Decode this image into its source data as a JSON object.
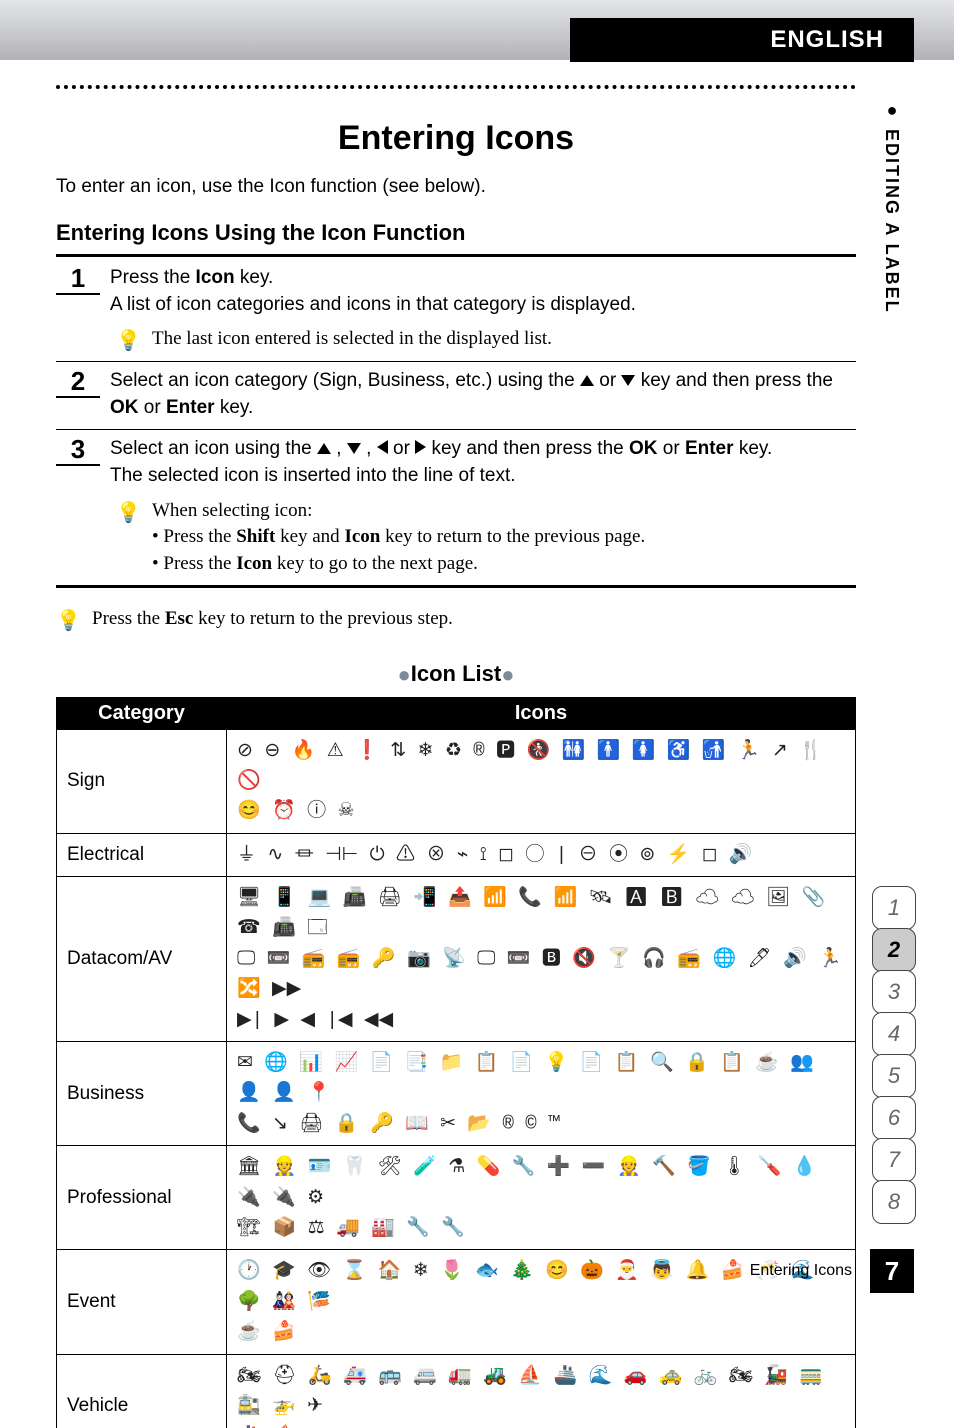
{
  "header": {
    "language_tab": "ENGLISH",
    "side_section_label": "EDITING A LABEL"
  },
  "page": {
    "title": "Entering Icons",
    "intro": "To enter an icon, use the Icon function (see below).",
    "section_heading": "Entering Icons Using the Icon Function"
  },
  "steps": [
    {
      "num": "1",
      "line1_before": "Press the ",
      "line1_key": "Icon",
      "line1_after": " key.",
      "line2": "A list of icon categories and icons in that category is displayed.",
      "tip": "The last icon entered is selected in the displayed list."
    },
    {
      "num": "2",
      "line_before": "Select an icon category (Sign, Business, etc.) using the ",
      "line_mid": " or ",
      "line_after_arrows": " key and then press the ",
      "key1": "OK",
      "or": " or ",
      "key2": "Enter",
      "line_end": " key."
    },
    {
      "num": "3",
      "line1_before": "Select an icon using the ",
      "sep": " , ",
      "or": " or ",
      "line1_mid": " key and then press the ",
      "key1": "OK",
      "or2": " or ",
      "key2": "Enter",
      "line1_end": " key.",
      "line2": "The selected icon is inserted into the line of text.",
      "tip_heading": "When selecting icon:",
      "tip_b1_before": "• Press the ",
      "tip_b1_k1": "Shift",
      "tip_b1_mid": " key and ",
      "tip_b1_k2": "Icon",
      "tip_b1_after": " key to return to the previous page.",
      "tip_b2_before": "• Press the ",
      "tip_b2_k": "Icon",
      "tip_b2_after": " key to go to the next page."
    }
  ],
  "outer_tip_before": "Press the ",
  "outer_tip_key": "Esc",
  "outer_tip_after": " key to return to the previous step.",
  "icon_list": {
    "title": "Icon List",
    "cat_header": "Category",
    "icons_header": "Icons",
    "rows": [
      {
        "category": "Sign",
        "icons": "⊘ ⊖ 🔥 ⚠ ❗ ⇅ ❄ ♻ ® 🅿 🚷 🚻 🚹 🚺 ♿ 🚮 🏃 ↗ 🍴 🚫\n😊 ⏰ ⓘ ☠"
      },
      {
        "category": "Electrical",
        "icons": "⏚ ∿ ⏛ ⊣⊢ ⏻ ⚠ ⊗ ⌁ ⟟ ◻ ◯ | ⊖ ⦿ ⊚ ⚡ ◻ 🔊"
      },
      {
        "category": "Datacom/AV",
        "icons": "🖥 📱 💻 📠 🖨 📲 📤 📶 📞 📶 🛰 🅰 🅱 ☁ ☁ 🖼 📎 ☎ 📠 🗔\n🖵 📼 📻 📻 🔑 📷 📡 🖵 📼 🅱 🔇 🍸 🎧 📻 🌐 🖊 🔊 🏃 🔀 ▶▶\n▶| ▶ ◀ |◀ ◀◀"
      },
      {
        "category": "Business",
        "icons": "✉ 🌐 📊 📈 📄 📑 📁 📋 📄 💡 📄 📋 🔍 🔒 📋 ☕ 👥 👤 👤 📍\n📞 ↘ 🖨 🔒 🔑 📖 ✂ 📂 ® © ™"
      },
      {
        "category": "Professional",
        "icons": "🏛 👷 🪪 🦷 🛠 🧪 ⚗ 💊 🔧 ➕ ➖ 👷 🔨 🪣 🌡 🪛 💧 🔌 🔌 ⚙\n🏗 📦 ⚖ 🚚 🏭 🔧 🔧"
      },
      {
        "category": "Event",
        "icons": "🕐 🎓 👁 ⌛ 🏠 ❄ 🌷 🐟 🎄 😊 🎃 🎅 👼 🔔 🍰 🥂 🌊 🌳 🎎 🎏\n☕ 🍰"
      },
      {
        "category": "Vehicle",
        "icons": "🏍 ⛑ 🛵 🚑 🚌 🚐 🚛 🚜 ⛵ 🚢 🌊 🚗 🚕 🚲 🏍 🚂 🚃 🚉 🚁 ✈\n🚢 ⛵"
      }
    ]
  },
  "page_tabs": [
    "1",
    "2",
    "3",
    "4",
    "5",
    "6",
    "7",
    "8"
  ],
  "active_tab": "2",
  "footer": {
    "label": "Entering Icons",
    "page_num": "7"
  }
}
